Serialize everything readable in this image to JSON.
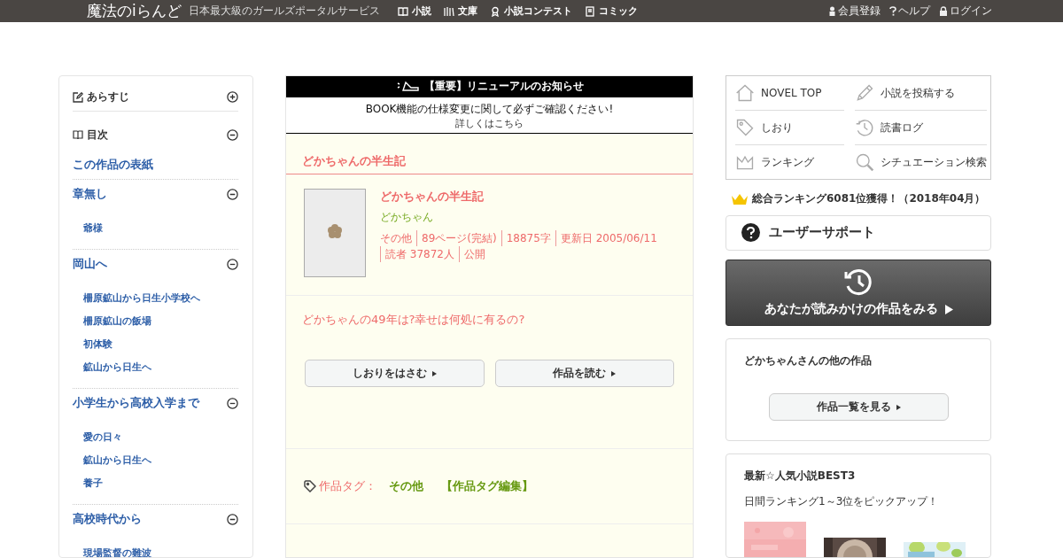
{
  "header": {
    "logo": "魔法のiらんど",
    "tagline": "日本最大級のガールズポータルサービス",
    "nav": [
      {
        "kind": "book",
        "label": "小説"
      },
      {
        "kind": "library",
        "label": "文庫"
      },
      {
        "kind": "award",
        "label": "小説コンテスト"
      },
      {
        "kind": "comic",
        "label": "コミック"
      }
    ],
    "account": [
      {
        "kind": "person",
        "label": "会員登録"
      },
      {
        "kind": "help",
        "label": "ヘルプ"
      },
      {
        "kind": "lock",
        "label": "ログイン"
      }
    ]
  },
  "sidebar": {
    "summary": {
      "label": "あらすじ",
      "expanded": false
    },
    "toc": {
      "label": "目次",
      "expanded": true
    },
    "cover_link": "この作品の表紙",
    "chapters": [
      {
        "title": "章無し",
        "expanded": true,
        "children": [
          {
            "title": "爺様"
          }
        ]
      },
      {
        "title": "岡山へ",
        "expanded": true,
        "children": [
          {
            "title": "柵原鉱山から日生小学校へ"
          },
          {
            "title": "柵原鉱山の飯場"
          },
          {
            "title": "初体験"
          },
          {
            "title": "鉱山から日生へ"
          }
        ]
      },
      {
        "title": "小学生から高校入学まで",
        "expanded": true,
        "children": [
          {
            "title": "愛の日々"
          },
          {
            "title": "鉱山から日生へ"
          },
          {
            "title": "養子"
          }
        ]
      },
      {
        "title": "高校時代から",
        "expanded": true,
        "children": [
          {
            "title": "現場監督の難波"
          }
        ]
      }
    ]
  },
  "notice": {
    "title": "【重要】リニューアルのお知らせ",
    "body": "BOOK機能の仕様変更に関して必ずご確認ください!",
    "link": "詳しくはこちら"
  },
  "work": {
    "heading": "どかちゃんの半生記",
    "title": "どかちゃんの半生記",
    "author": "どかちゃん",
    "meta": [
      "その他",
      "89ページ(完結)",
      "18875字",
      "更新日 2005/06/11",
      "読者 37872人",
      "公開"
    ],
    "catch": "どかちゃんの49年は?幸せは何処に有るの?",
    "buttons": [
      "しおりをはさむ",
      "作品を読む"
    ],
    "tag_label": "作品タグ：",
    "tags": [
      "その他"
    ],
    "tag_edit": "【作品タグ編集】"
  },
  "menu": [
    {
      "kind": "home",
      "label": "NOVEL TOP"
    },
    {
      "kind": "pencil",
      "label": "小説を投稿する"
    },
    {
      "kind": "tag",
      "label": "しおり"
    },
    {
      "kind": "history",
      "label": "読書ログ"
    },
    {
      "kind": "crown",
      "label": "ランキング"
    },
    {
      "kind": "search",
      "label": "シチュエーション検索"
    }
  ],
  "ranking": "総合ランキング6081位獲得！（2018年04月）",
  "support": "ユーザーサポート",
  "continue_reading": "あなたが読みかけの作品をみる",
  "other_works": {
    "title": "どかちゃんさんの他の作品",
    "button": "作品一覧を見る"
  },
  "best3": {
    "title": "最新☆人気小説BEST3",
    "subtitle": "日間ランキング1～3位をピックアップ！",
    "covers": [
      {
        "kind": "pink"
      },
      {
        "kind": "picture"
      },
      {
        "kind": "picture"
      }
    ]
  }
}
